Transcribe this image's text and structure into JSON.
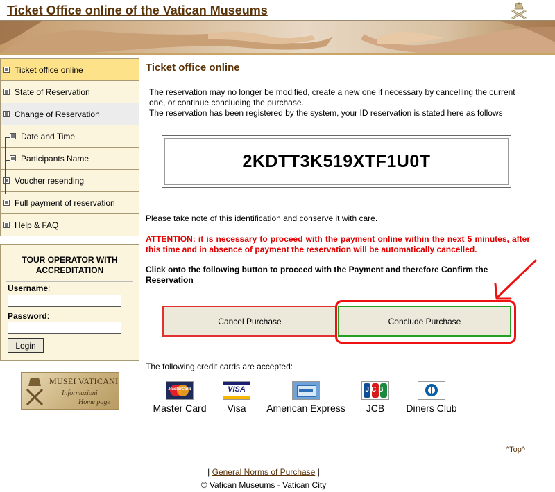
{
  "header": {
    "site_title": "Ticket Office online of the Vatican Museums"
  },
  "sidebar": {
    "items": [
      {
        "label": "Ticket office online"
      },
      {
        "label": "State of Reservation"
      },
      {
        "label": "Change of Reservation"
      },
      {
        "label": "Date and Time"
      },
      {
        "label": "Participants Name"
      },
      {
        "label": "Voucher resending"
      },
      {
        "label": "Full payment of reservation"
      },
      {
        "label": "Help & FAQ"
      }
    ],
    "login": {
      "heading": "TOUR OPERATOR WITH ACCREDITATION",
      "username_label": "Username",
      "password_label": "Password",
      "colon": ":",
      "username_value": "",
      "password_value": "",
      "login_button": "Login"
    },
    "museum_logo": {
      "title": "MUSEI VATICANI",
      "line1": "Informazioni",
      "line2": "Home page"
    }
  },
  "main": {
    "heading": "Ticket office online",
    "intro_1": "The reservation may no longer be modified, create a new one if necessary by cancelling the current one, or continue concluding the purchase.",
    "intro_2": "The reservation has been registered by the system, your ID reservation is stated here as follows",
    "reservation_id": "2KDTT3K519XTF1U0T",
    "note": "Please take note of this identification and conserve it with care.",
    "attention": "ATTENTION: it is necessary to proceed with the payment online within the next 5 minutes, after this time and in absence of payment the reservation will be automatically cancelled.",
    "instruction": "Click onto the following button to proceed with the Payment and therefore Confirm the Reservation",
    "cancel_button": "Cancel Purchase",
    "conclude_button": "Conclude Purchase",
    "cards_label": "The following credit cards are accepted:",
    "cards": [
      {
        "name": "Master Card",
        "icon": "mastercard-icon",
        "badge": "MasterCard"
      },
      {
        "name": "Visa",
        "icon": "visa-icon",
        "badge": "VISA"
      },
      {
        "name": "American Express",
        "icon": "amex-icon",
        "badge": ""
      },
      {
        "name": "JCB",
        "icon": "jcb-icon",
        "badge": "JCB"
      },
      {
        "name": "Diners Club",
        "icon": "diners-club-icon",
        "badge": ""
      }
    ]
  },
  "footer": {
    "top_link": "^Top^",
    "pipe": "|",
    "norms_link": "General Norms of Purchase",
    "copyright": "© Vatican Museums - Vatican City"
  },
  "colors": {
    "title_brown": "#5a3308",
    "attention_red": "#e10000",
    "active_menu": "#fde289",
    "menu_bg": "#fbf5de",
    "highlight_red": "#ee1111",
    "confirm_green": "#22a022"
  }
}
